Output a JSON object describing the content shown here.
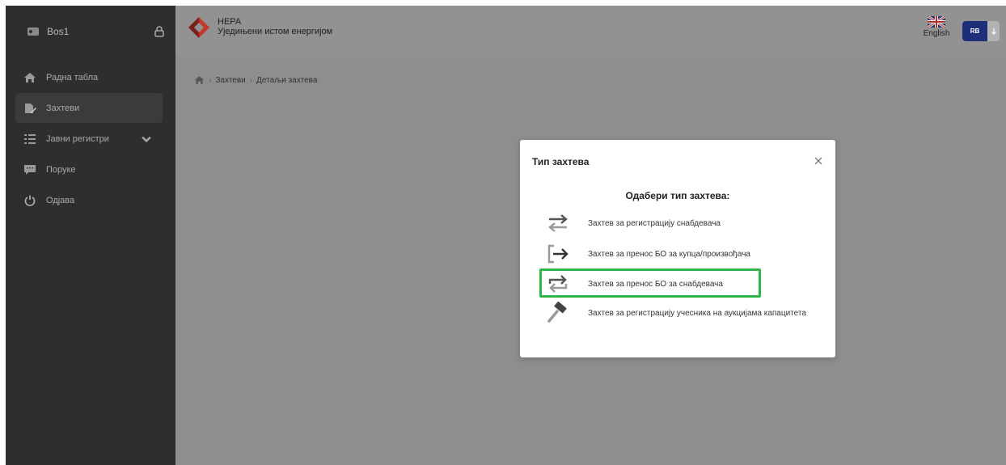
{
  "sidebar": {
    "user_name": "Bos1",
    "items": [
      {
        "label": "Радна табла",
        "icon": "home-icon"
      },
      {
        "label": "Захтеви",
        "icon": "edit-document-icon",
        "active": true
      },
      {
        "label": "Јавни регистри",
        "icon": "list-icon",
        "has_submenu": true
      },
      {
        "label": "Поруке",
        "icon": "message-icon"
      },
      {
        "label": "Одјава",
        "icon": "power-icon"
      }
    ]
  },
  "header": {
    "brand_name": "НЕРА",
    "brand_subtitle": "Уједињени истом енергијом",
    "language_label": "English",
    "avatar_initials": "RB"
  },
  "breadcrumb": [
    "Захтеви",
    "Детаљи захтева"
  ],
  "modal": {
    "title": "Тип захтева",
    "heading": "Одабери тип захтева:",
    "options": [
      {
        "label": "Захтев за регистрацију снабдевача",
        "icon": "swap-arrows-icon"
      },
      {
        "label": "Захтев за пренос БО за купца/произвођача",
        "icon": "enter-arrow-icon"
      },
      {
        "label": "Захтев за пренос БО за снабдевача",
        "icon": "repeat-arrows-icon",
        "highlighted": true
      },
      {
        "label": "Захтев за регистрацију учесника на аукцијама капацитета",
        "icon": "gavel-icon"
      }
    ]
  },
  "colors": {
    "sidebar_bg": "#2e2e2e",
    "overlay_bg": "#8e8e8e",
    "avatar_bg": "#1e2f7a",
    "highlight": "#2fb64a",
    "logo_red": "#c0392b"
  }
}
